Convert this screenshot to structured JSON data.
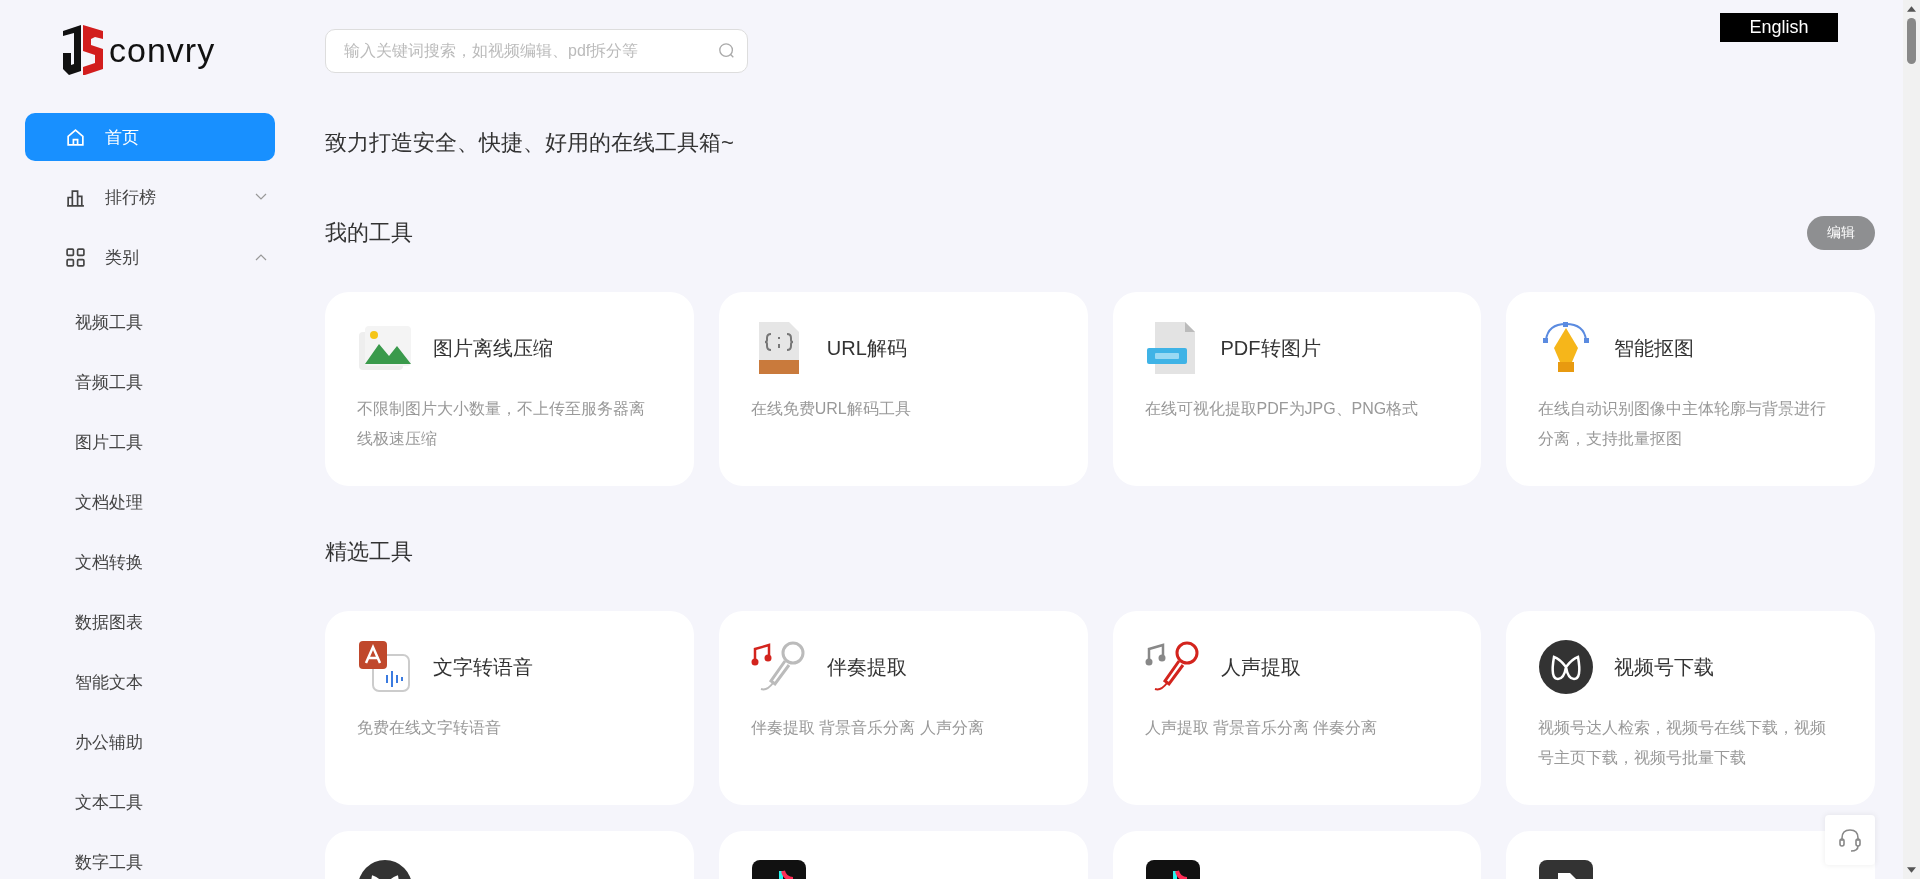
{
  "logo": {
    "text": "convry"
  },
  "nav": [
    {
      "label": "首页",
      "selected": true
    },
    {
      "label": "排行榜",
      "selected": false,
      "expanded": false
    },
    {
      "label": "类别",
      "selected": false,
      "expanded": true,
      "children": [
        {
          "label": "视频工具"
        },
        {
          "label": "音频工具"
        },
        {
          "label": "图片工具"
        },
        {
          "label": "文档处理"
        },
        {
          "label": "文档转换"
        },
        {
          "label": "数据图表"
        },
        {
          "label": "智能文本"
        },
        {
          "label": "办公辅助"
        },
        {
          "label": "文本工具"
        },
        {
          "label": "数字工具"
        }
      ]
    }
  ],
  "search": {
    "placeholder": "输入关键词搜索，如视频编辑、pdf拆分等"
  },
  "language_button": "English",
  "tagline": "致力打造安全、快捷、好用的在线工具箱~",
  "sections": [
    {
      "title": "我的工具",
      "action": "编辑",
      "tools": [
        {
          "kind": "photo",
          "title": "图片离线压缩",
          "description": "不限制图片大小数量，不上传至服务器离线极速压缩"
        },
        {
          "kind": "url",
          "title": "URL解码",
          "description": "在线免费URL解码工具"
        },
        {
          "kind": "jpg",
          "title": "PDF转图片",
          "description": "在线可视化提取PDF为JPG、PNG格式"
        },
        {
          "kind": "pen",
          "title": "智能抠图",
          "description": "在线自动识别图像中主体轮廓与背景进行分离，支持批量抠图"
        }
      ]
    },
    {
      "title": "精选工具",
      "tools": [
        {
          "kind": "tts",
          "title": "文字转语音",
          "description": "免费在线文字转语音"
        },
        {
          "kind": "karaoke",
          "title": "伴奏提取",
          "description": "伴奏提取 背景音乐分离 人声分离"
        },
        {
          "kind": "vocal",
          "title": "人声提取",
          "description": "人声提取 背景音乐分离 伴奏分离"
        },
        {
          "kind": "channels",
          "title": "视频号下载",
          "description": "视频号达人检索，视频号在线下载，视频号主页下载，视频号批量下载"
        },
        {
          "kind": "channels"
        },
        {
          "kind": "tiktok"
        },
        {
          "kind": "tiktok"
        },
        {
          "kind": "live"
        }
      ]
    }
  ]
}
